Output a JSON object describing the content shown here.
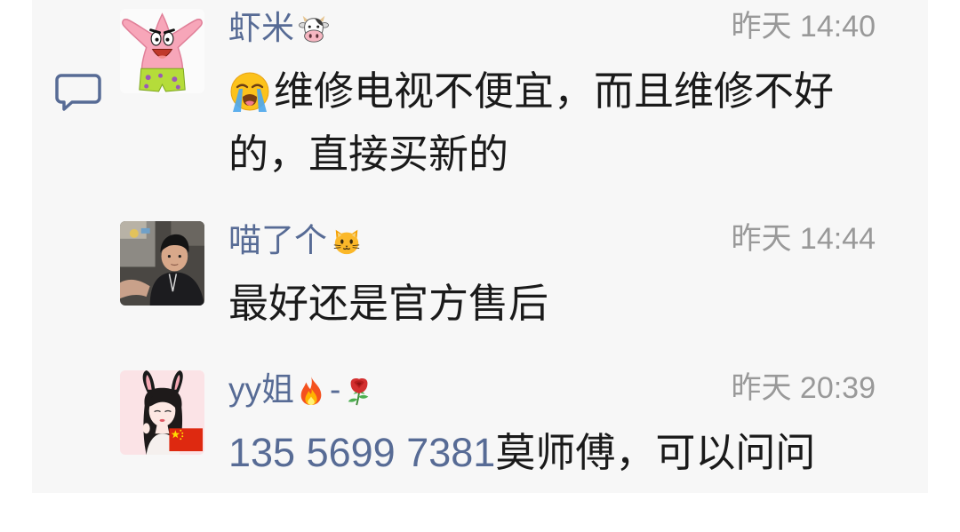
{
  "colors": {
    "name": "#576b95",
    "link": "#576b95",
    "text": "#1a1a1a",
    "time": "#999999",
    "panel_bg": "#f7f7f7"
  },
  "comment_icon": "comment-bubble-icon",
  "comments": [
    {
      "avatar": "patrick-star-avatar",
      "name": {
        "text": "虾米",
        "emoji": "cow-face-emoji"
      },
      "time": "昨天 14:40",
      "body": {
        "emoji": "loudly-crying-face-emoji",
        "text": "维修电视不便宜，而且维修不好的，直接买新的"
      }
    },
    {
      "avatar": "child-photo-avatar",
      "name": {
        "text": "喵了个",
        "emoji": "cat-face-emoji"
      },
      "time": "昨天 14:44",
      "body": {
        "text": "最好还是官方售后"
      }
    },
    {
      "avatar": "bunny-ears-girl-avatar",
      "name": {
        "text": "yy姐",
        "emoji": "fire-emoji",
        "separator": "-",
        "emoji2": "rose-emoji"
      },
      "time": "昨天 20:39",
      "body": {
        "phone_link": "135 5699 7381",
        "text": "莫师傅，可以问问"
      }
    }
  ]
}
